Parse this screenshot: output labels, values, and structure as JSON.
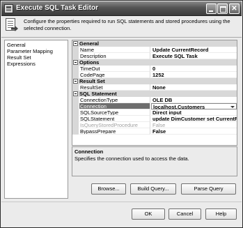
{
  "window": {
    "title": "Execute SQL Task Editor",
    "header_text": "Configure the properties required to run SQL statements and stored procedures using the selected connection."
  },
  "nav": {
    "items": [
      {
        "label": "General"
      },
      {
        "label": "Parameter Mapping"
      },
      {
        "label": "Result Set"
      },
      {
        "label": "Expressions"
      }
    ]
  },
  "grid": {
    "categories": [
      {
        "label": "General",
        "properties": [
          {
            "name": "Name",
            "value": "Update CurrentRecord"
          },
          {
            "name": "Description",
            "value": "Execute SQL Task"
          }
        ]
      },
      {
        "label": "Options",
        "properties": [
          {
            "name": "TimeOut",
            "value": "0"
          },
          {
            "name": "CodePage",
            "value": "1252"
          }
        ]
      },
      {
        "label": "Result Set",
        "properties": [
          {
            "name": "ResultSet",
            "value": "None"
          }
        ]
      },
      {
        "label": "SQL Statement",
        "properties": [
          {
            "name": "ConnectionType",
            "value": "OLE DB"
          },
          {
            "name": "Connection",
            "value": "localhost.Customers",
            "selected": true
          },
          {
            "name": "SQLSourceType",
            "value": "Direct input"
          },
          {
            "name": "SQLStatement",
            "value": "update DimCustomer set CurrentRe"
          },
          {
            "name": "IsQueryStoredProcedure",
            "value": "False",
            "disabled": true
          },
          {
            "name": "BypassPrepare",
            "value": "False"
          }
        ]
      }
    ]
  },
  "description": {
    "title": "Connection",
    "text": "Specifies the connection used to access the data."
  },
  "buttons": {
    "browse": "Browse...",
    "build_query": "Build Query...",
    "parse_query": "Parse Query",
    "ok": "OK",
    "cancel": "Cancel",
    "help": "Help"
  }
}
